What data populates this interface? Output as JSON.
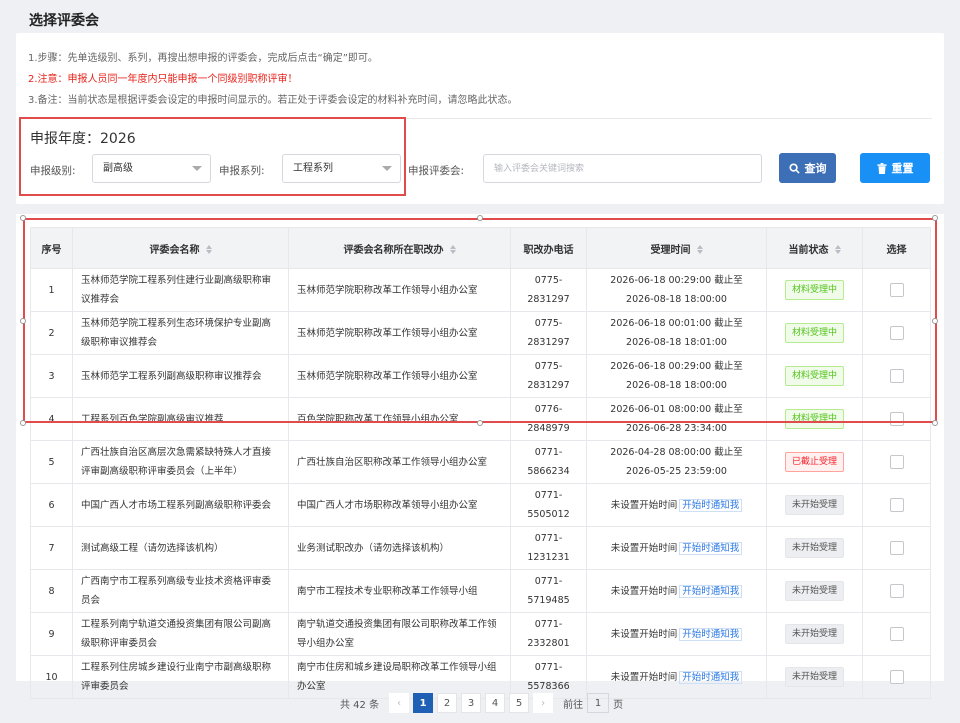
{
  "page": {
    "title": "选择评委会"
  },
  "instructions": {
    "step1": "1.步骤：先单选级别、系列，再搜出想申报的评委会，完成后点击“确定”即可。",
    "step2": "2.注意：申报人员同一年度内只能申报一个同级别职称评审！",
    "step3": "3.备注：当前状态是根据评委会设定的申报时间显示的。若正处于评委会设定的材料补充时间，请忽略此状态。"
  },
  "filters": {
    "year_label": "申报年度：2026",
    "level_label": "申报级别:",
    "level_value": "副高级",
    "series_label": "申报系列:",
    "series_value": "工程系列",
    "committee_label": "申报评委会:",
    "committee_placeholder": "输入评委会关键词搜索",
    "query_label": "查询",
    "reset_label": "重置"
  },
  "table": {
    "headers": [
      "序号",
      "评委会名称",
      "评委会名称所在职改办",
      "职改办电话",
      "受理时间",
      "当前状态",
      "选择"
    ],
    "rows": [
      {
        "no": "1",
        "name": "玉林师范学院工程系列住建行业副高级职称审议推荐会",
        "office": "玉林师范学院职称改革工作领导小组办公室",
        "phone": "0775-2831297",
        "time": "2026-06-18 00:29:00 截止至 2026-08-18 18:00:00",
        "status": "材料受理中",
        "notify": ""
      },
      {
        "no": "2",
        "name": "玉林师范学院工程系列生态环境保护专业副高级职称审议推荐会",
        "office": "玉林师范学院职称改革工作领导小组办公室",
        "phone": "0775-2831297",
        "time": "2026-06-18 00:01:00 截止至 2026-08-18 18:01:00",
        "status": "材料受理中",
        "notify": ""
      },
      {
        "no": "3",
        "name": "玉林师范学工程系列副高级职称审议推荐会",
        "office": "玉林师范学院职称改革工作领导小组办公室",
        "phone": "0775-2831297",
        "time": "2026-06-18 00:29:00 截止至 2026-08-18 18:00:00",
        "status": "材料受理中",
        "notify": ""
      },
      {
        "no": "4",
        "name": "工程系列百色学院副高级审议推荐",
        "office": "百色学院职称改革工作领导小组办公室",
        "phone": "0776-2848979",
        "time": "2026-06-01 08:00:00 截止至 2026-06-28 23:34:00",
        "status": "材料受理中",
        "notify": ""
      },
      {
        "no": "5",
        "name": "广西壮族自治区高层次急需紧缺特殊人才直接评审副高级职称评审委员会（上半年）",
        "office": "广西壮族自治区职称改革工作领导小组办公室",
        "phone": "0771-5866234",
        "time": "2026-04-28 08:00:00 截止至 2026-05-25 23:59:00",
        "status": "已截止受理",
        "notify": ""
      },
      {
        "no": "6",
        "name": "中国广西人才市场工程系列副高级职称评委会",
        "office": "中国广西人才市场职称改革领导小组办公室",
        "phone": "0771-5505012",
        "time": "未设置开始时间",
        "status": "未开始受理",
        "notify": "开始时通知我"
      },
      {
        "no": "7",
        "name": "测试高级工程（请勿选择该机构）",
        "office": "业务测试职改办（请勿选择该机构）",
        "phone": "0771-1231231",
        "time": "未设置开始时间",
        "status": "未开始受理",
        "notify": "开始时通知我"
      },
      {
        "no": "8",
        "name": "广西南宁市工程系列高级专业技术资格评审委员会",
        "office": "南宁市工程技术专业职称改革工作领导小组",
        "phone": "0771-5719485",
        "time": "未设置开始时间",
        "status": "未开始受理",
        "notify": "开始时通知我"
      },
      {
        "no": "9",
        "name": "工程系列南宁轨道交通投资集团有限公司副高级职称评审委员会",
        "office": "南宁轨道交通投资集团有限公司职称改革工作领导小组办公室",
        "phone": "0771-2332801",
        "time": "未设置开始时间",
        "status": "未开始受理",
        "notify": "开始时通知我"
      },
      {
        "no": "10",
        "name": "工程系列住房城乡建设行业南宁市副高级职称评审委员会",
        "office": "南宁市住房和城乡建设局职称改革工作领导小组办公室",
        "phone": "0771-5578366",
        "time": "未设置开始时间",
        "status": "未开始受理",
        "notify": "开始时通知我"
      }
    ]
  },
  "pagination": {
    "total": "共 42 条",
    "pages": [
      "1",
      "2",
      "3",
      "4",
      "5"
    ],
    "current": "1",
    "goto_label": "前往",
    "goto_value": "1",
    "page_suffix": "页"
  },
  "colors": {
    "primary": "#3d6fb6",
    "reset": "#1990f5",
    "highlight_box": "#e04b4b",
    "warning_text": "#e8231b"
  }
}
